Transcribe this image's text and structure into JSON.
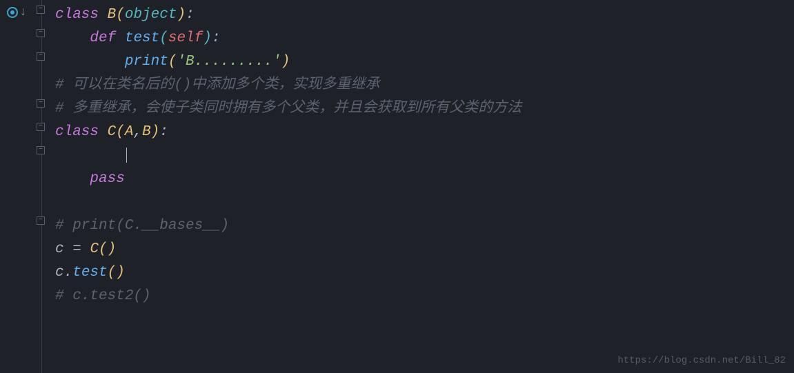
{
  "code": {
    "l1_kw_class": "class",
    "l1_cls": "B",
    "l1_builtin": "object",
    "l2_kw_def": "def",
    "l2_fn": "test",
    "l2_self": "self",
    "l3_fn": "print",
    "l3_str": "'B.........'",
    "l4_comment": "# 可以在类名后的()中添加多个类，实现多重继承",
    "l5_comment": "# 多重继承，会使子类同时拥有多个父类，并且会获取到所有父类的方法",
    "l6_kw_class": "class",
    "l6_cls": "C",
    "l6_arg_a": "A",
    "l6_arg_b": "B",
    "l8_pass": "pass",
    "l10_comment": "# print(C.__bases__)",
    "l11_var": "c",
    "l11_op": "=",
    "l11_cls": "C",
    "l12_var": "c",
    "l12_fn": "test",
    "l13_comment": "# c.test2()"
  },
  "watermark": "https://blog.csdn.net/Bill_82"
}
